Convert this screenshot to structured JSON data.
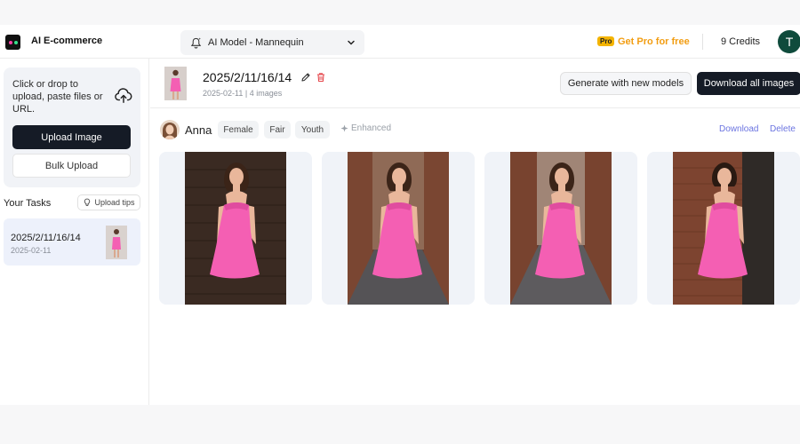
{
  "header": {
    "app_title": "AI E-commerce",
    "model_select_value": "AI Model - Mannequin",
    "pro_badge": "Pro",
    "pro_link": "Get Pro for free",
    "credits": "9 Credits",
    "avatar_initial": "T"
  },
  "sidebar": {
    "upload_hint": "Click or drop to upload, paste files or URL.",
    "upload_button": "Upload Image",
    "bulk_button": "Bulk Upload",
    "tasks_title": "Your Tasks",
    "tips_button": "Upload tips",
    "tasks": [
      {
        "name": "2025/2/11/16/14",
        "date": "2025-02-11"
      }
    ]
  },
  "main": {
    "task_name": "2025/2/11/16/14",
    "task_meta": "2025-02-11 | 4 images",
    "generate_button": "Generate with new models",
    "download_all_button": "Download all images",
    "model": {
      "name": "Anna",
      "tags": [
        "Female",
        "Fair",
        "Youth"
      ],
      "enhanced_label": "Enhanced",
      "download_link": "Download",
      "delete_link": "Delete"
    },
    "images": [
      {
        "background": "dark-brick"
      },
      {
        "background": "alley-street"
      },
      {
        "background": "alley-street"
      },
      {
        "background": "brick-doorway"
      }
    ]
  },
  "colors": {
    "primary_button": "#151b26",
    "accent_orange": "#f29d12",
    "link_purple": "#6b74e0",
    "dress_pink": "#f45fb3",
    "avatar_green": "#0f4b3c",
    "delete_red": "#e5484d"
  }
}
